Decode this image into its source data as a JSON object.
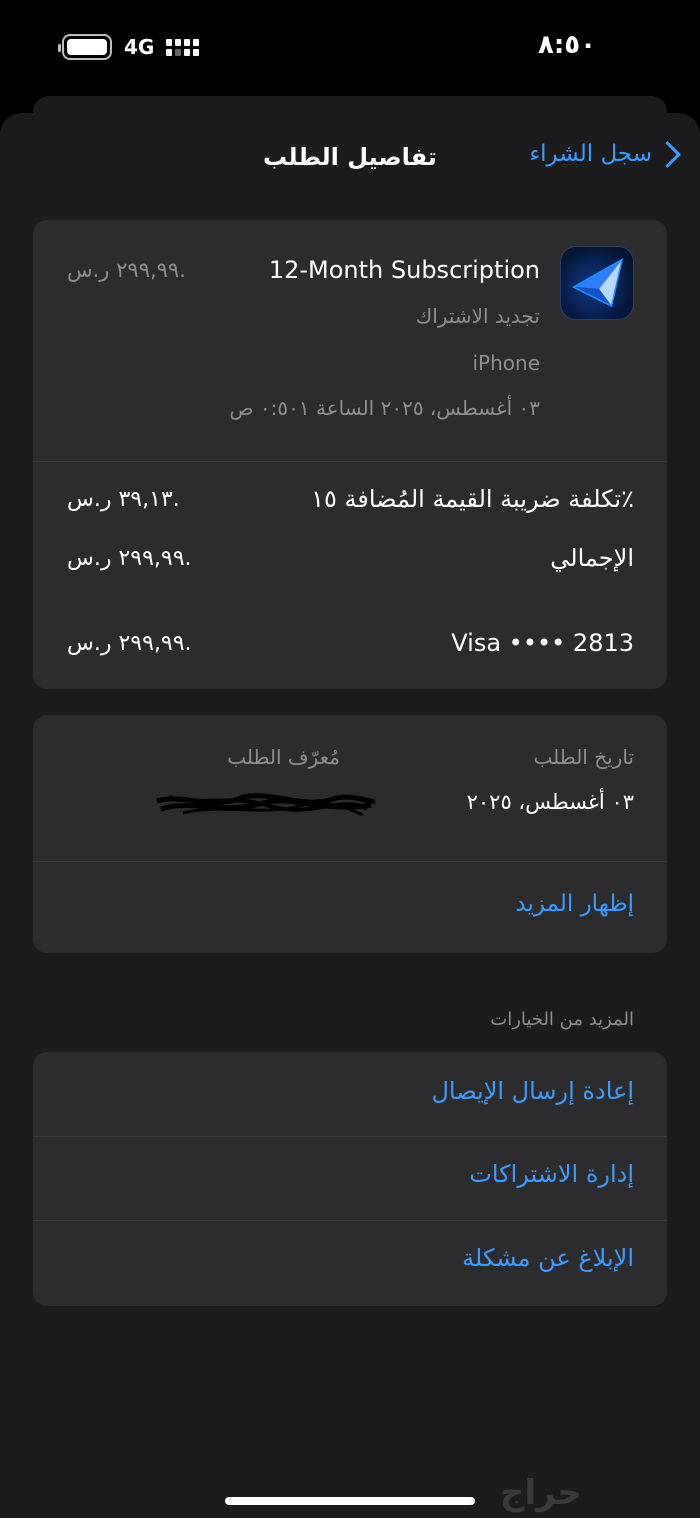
{
  "status": {
    "time": "٨:٥٠",
    "network": "4G",
    "battery_level": 1.0
  },
  "nav": {
    "back_label": "سجل الشراء",
    "title": "تفاصيل الطلب"
  },
  "purchase": {
    "title": "12-Month Subscription",
    "price": "٢٩٩,٩٩ ر.س.",
    "type": "تجديد الاشتراك",
    "device": "iPhone",
    "datetime": "٠٣ أغسطس، ٢٠٢٥ الساعة ٠:٥٠١ ص"
  },
  "summary": {
    "vat_label": "تكلفة ضريبة القيمة المُضافة ١٥٪",
    "vat_value": "٣٩,١٣ ر.س.",
    "total_label": "الإجمالي",
    "total_value": "٢٩٩,٩٩ ر.س.",
    "payment_label": "Visa •••• 2813",
    "payment_value": "٢٩٩,٩٩ ر.س."
  },
  "order": {
    "date_label": "تاريخ الطلب",
    "date_value": "٠٣ أغسطس، ٢٠٢٥",
    "id_label": "مُعرّف الطلب",
    "show_more": "إظهار المزيد"
  },
  "more_options": {
    "header": "المزيد من الخيارات",
    "items": [
      "إعادة إرسال الإيصال",
      "إدارة الاشتراكات",
      "الإبلاغ عن مشكلة"
    ]
  },
  "watermark": "حراج",
  "colors": {
    "accent": "#3d9bff",
    "card": "#2c2c2e",
    "sheet": "#1c1c1e",
    "secondary_text": "#8e8e93"
  }
}
